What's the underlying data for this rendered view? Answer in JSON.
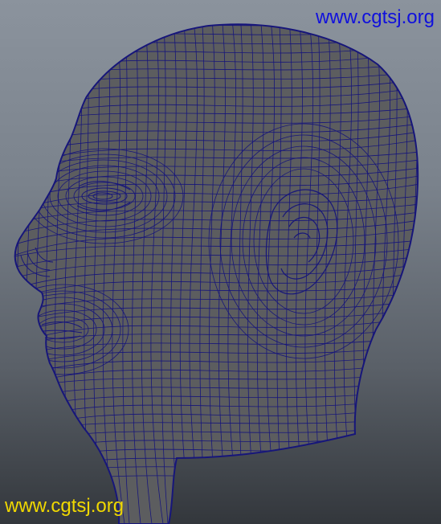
{
  "viewport": {
    "subject": "head-wireframe-model",
    "background_top": "#8b939d",
    "background_bottom": "#33373c",
    "surface_color": "#5c5d5f",
    "wire_color": "#17167a"
  },
  "watermarks": {
    "top_text": "www.cgtsj.org",
    "top_color": "#1010dd",
    "bottom_text": "www.cgtsj.org",
    "bottom_color": "#f0d800"
  }
}
